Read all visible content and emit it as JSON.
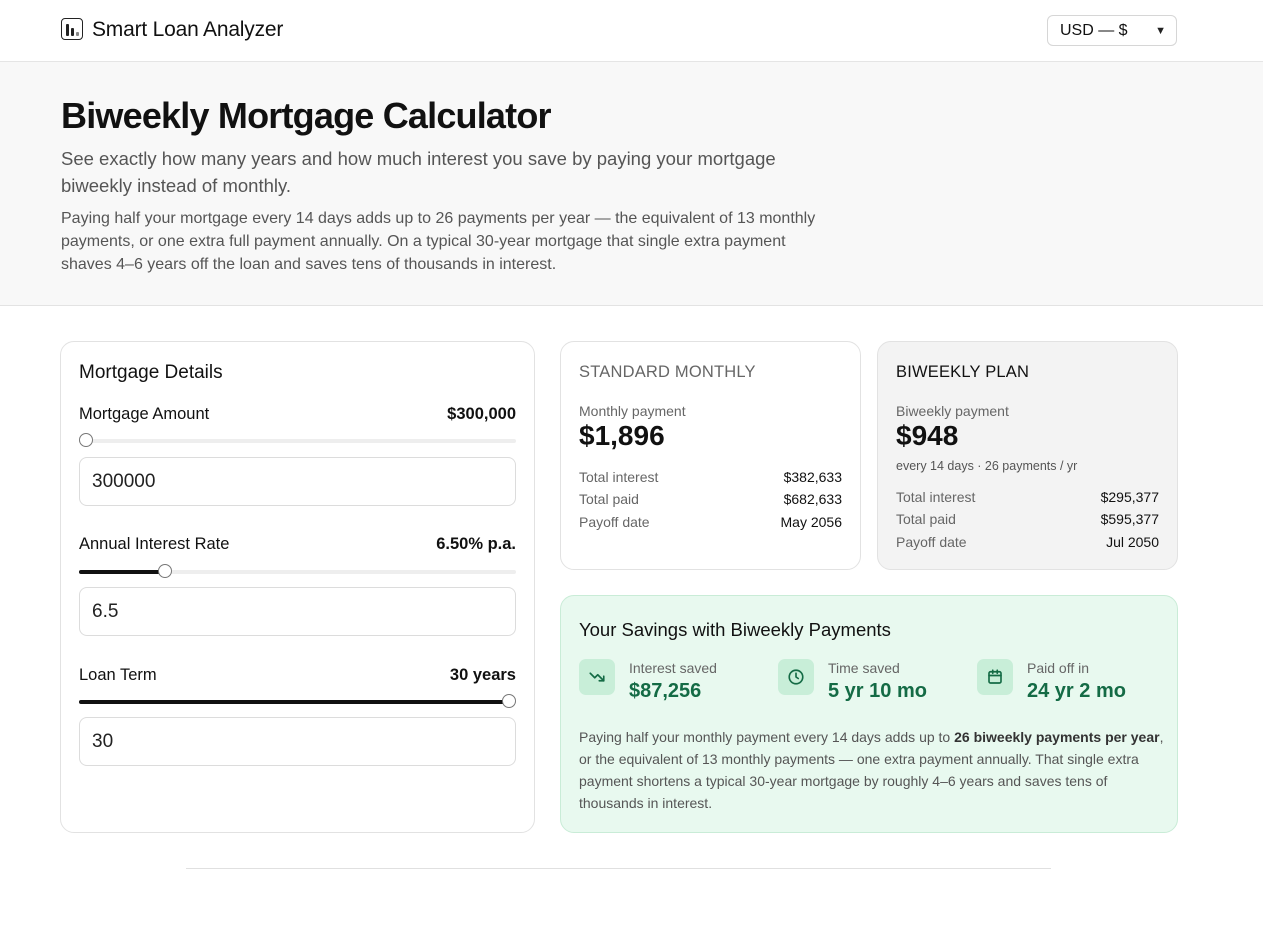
{
  "header": {
    "brand": "Smart Loan Analyzer",
    "currency_selected": "USD — $",
    "icons": {
      "logo": "bar-chart-logo-icon",
      "chevron": "chevron-down-icon"
    }
  },
  "hero": {
    "title": "Biweekly Mortgage Calculator",
    "subtitle": "See exactly how many years and how much interest you save by paying your mortgage biweekly instead of monthly.",
    "description": "Paying half your mortgage every 14 days adds up to 26 payments per year — the equivalent of 13 monthly payments, or one extra full payment annually. On a typical 30-year mortgage that single extra payment shaves 4–6 years off the loan and saves tens of thousands in interest."
  },
  "details": {
    "title": "Mortgage Details",
    "amount": {
      "label": "Mortgage Amount",
      "display": "$300,000",
      "input": "300000",
      "slider_fraction": 0.0
    },
    "rate": {
      "label": "Annual Interest Rate",
      "display": "6.50% p.a.",
      "input": "6.5",
      "slider_fraction": 0.186
    },
    "term": {
      "label": "Loan Term",
      "display": "30 years",
      "input": "30",
      "slider_fraction": 1.0
    }
  },
  "standard": {
    "title": "STANDARD MONTHLY",
    "payment_label": "Monthly payment",
    "payment": "$1,896",
    "rows": [
      {
        "k": "Total interest",
        "v": "$382,633"
      },
      {
        "k": "Total paid",
        "v": "$682,633"
      },
      {
        "k": "Payoff date",
        "v": "May 2056"
      }
    ]
  },
  "biweekly": {
    "title": "BIWEEKLY PLAN",
    "payment_label": "Biweekly payment",
    "payment": "$948",
    "note": "every 14 days · 26 payments / yr",
    "rows": [
      {
        "k": "Total interest",
        "v": "$295,377"
      },
      {
        "k": "Total paid",
        "v": "$595,377"
      },
      {
        "k": "Payoff date",
        "v": "Jul 2050"
      }
    ]
  },
  "savings": {
    "title": "Your Savings with Biweekly Payments",
    "stats": [
      {
        "label": "Interest saved",
        "value": "$87,256",
        "icon": "trending-down-icon"
      },
      {
        "label": "Time saved",
        "value": "5 yr 10 mo",
        "icon": "clock-icon"
      },
      {
        "label": "Paid off in",
        "value": "24 yr 2 mo",
        "icon": "calendar-icon"
      }
    ],
    "para_a": "Paying half your monthly payment every 14 days adds up to ",
    "para_bold": "26 biweekly payments per year",
    "para_b": ", or the equivalent of 13 monthly payments — one extra payment annually. That single extra payment shortens a typical 30-year mortgage by roughly 4–6 years and saves tens of thousands in interest."
  },
  "colors": {
    "accent_green": "#146b45",
    "savings_bg": "#e8f9ef",
    "icon_bg": "#c8eed8"
  }
}
